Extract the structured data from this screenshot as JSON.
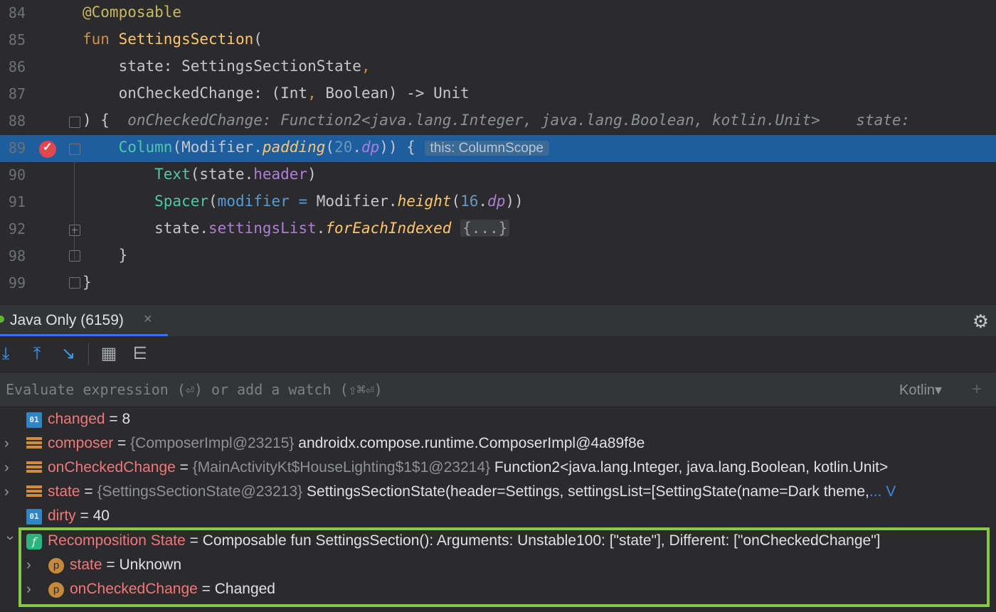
{
  "editor": {
    "lines": [
      {
        "num": "84",
        "tokens": [
          [
            "k-anno",
            "@Composable"
          ]
        ]
      },
      {
        "num": "85",
        "tokens": [
          [
            "k-kw",
            "fun "
          ],
          [
            "k-fn",
            "SettingsSection"
          ],
          [
            "k-punct",
            "("
          ]
        ]
      },
      {
        "num": "86",
        "tokens": [
          [
            "k-punct",
            "    state: SettingsSectionState"
          ],
          [
            "k-kw",
            ","
          ]
        ]
      },
      {
        "num": "87",
        "tokens": [
          [
            "k-punct",
            "    onCheckedChange: (Int"
          ],
          [
            "k-kw",
            ", "
          ],
          [
            "k-punct",
            "Boolean) -> Unit"
          ]
        ]
      },
      {
        "num": "88",
        "tokens": [
          [
            "k-punct",
            ") {  "
          ],
          [
            "k-hint",
            "onCheckedChange: Function2<java.lang.Integer, java.lang.Boolean, kotlin.Unit>    state: "
          ]
        ]
      },
      {
        "num": "89",
        "tokens": [
          [
            "k-col",
            "    Column"
          ],
          [
            "k-punct",
            "(Modifier."
          ],
          [
            "k-call",
            "padding"
          ],
          [
            "k-punct",
            "("
          ],
          [
            "k-num",
            "20"
          ],
          [
            "k-punct",
            "."
          ],
          [
            "k-ext",
            "dp"
          ],
          [
            "k-punct",
            ")) { "
          ],
          [
            "inlay",
            "this: ColumnScope"
          ]
        ]
      },
      {
        "num": "90",
        "tokens": [
          [
            "k-col",
            "        Text"
          ],
          [
            "k-punct",
            "(state."
          ],
          [
            "k-prop",
            "header"
          ],
          [
            "k-punct",
            ")"
          ]
        ]
      },
      {
        "num": "91",
        "tokens": [
          [
            "k-col",
            "        Spacer"
          ],
          [
            "k-punct",
            "("
          ],
          [
            "k-param",
            "modifier"
          ],
          [
            "k-punct",
            " "
          ],
          [
            "k-param",
            "="
          ],
          [
            "k-punct",
            " Modifier."
          ],
          [
            "k-call",
            "height"
          ],
          [
            "k-punct",
            "("
          ],
          [
            "k-num",
            "16"
          ],
          [
            "k-punct",
            "."
          ],
          [
            "k-ext",
            "dp"
          ],
          [
            "k-punct",
            "))"
          ]
        ]
      },
      {
        "num": "92",
        "tokens": [
          [
            "k-punct",
            "        state."
          ],
          [
            "k-prop",
            "settingsList"
          ],
          [
            "k-punct",
            "."
          ],
          [
            "k-call",
            "forEachIndexed"
          ],
          [
            "k-punct",
            " "
          ],
          [
            "fold-box",
            "{...}"
          ]
        ]
      },
      {
        "num": "98",
        "tokens": [
          [
            "k-punct",
            "    }"
          ]
        ]
      },
      {
        "num": "99",
        "tokens": [
          [
            "k-punct",
            "}"
          ]
        ]
      }
    ]
  },
  "debugger": {
    "tab_label": "Java Only (6159)",
    "tab_close": "×",
    "settings_icon": "gear-icon",
    "toolbar": {
      "step_into": "⤓",
      "step_out": "⤒",
      "run_to_cursor": "↘",
      "evaluate": "▦",
      "trace": "⋿"
    },
    "eval_placeholder": "Evaluate expression (⏎) or add a watch (⇧⌘⏎)",
    "language": "Kotlin▾",
    "add_watch": "+"
  },
  "variables": [
    {
      "name": "changed",
      "eq": " = ",
      "id": "",
      "value": "8",
      "icon": "prim",
      "icon_text": "01"
    },
    {
      "name": "composer",
      "eq": " = ",
      "id": "{ComposerImpl@23215} ",
      "value": "androidx.compose.runtime.ComposerImpl@4a89f8e",
      "icon": "obj"
    },
    {
      "name": "onCheckedChange",
      "eq": " = ",
      "id": "{MainActivityKt$HouseLighting$1$1@23214} ",
      "value": "Function2<java.lang.Integer, java.lang.Boolean, kotlin.Unit>",
      "icon": "obj"
    },
    {
      "name": "state",
      "eq": " = ",
      "id": "{SettingsSectionState@23213} ",
      "value": "SettingsSectionState(header=Settings, settingsList=[SettingState(name=Dark theme,",
      "more": "... V",
      "icon": "obj"
    },
    {
      "name": "dirty",
      "eq": " = ",
      "id": "",
      "value": "40",
      "icon": "prim",
      "icon_text": "01"
    },
    {
      "name": "Recomposition State",
      "eq": " = ",
      "id": "",
      "value": "Composable fun SettingsSection(): Arguments: Unstable100: [\"state\"], Different: [\"onCheckedChange\"]",
      "icon": "fn",
      "icon_text": "f"
    },
    {
      "name": "state",
      "eq": " = ",
      "id": "",
      "value": "Unknown",
      "icon": "p",
      "icon_text": "p"
    },
    {
      "name": "onCheckedChange",
      "eq": " = ",
      "id": "",
      "value": "Changed",
      "icon": "p",
      "icon_text": "p"
    }
  ],
  "colors": {
    "highlight": "#1f5e9e",
    "annotation_box": "#85c94a",
    "variable_name": "#f2777a"
  }
}
